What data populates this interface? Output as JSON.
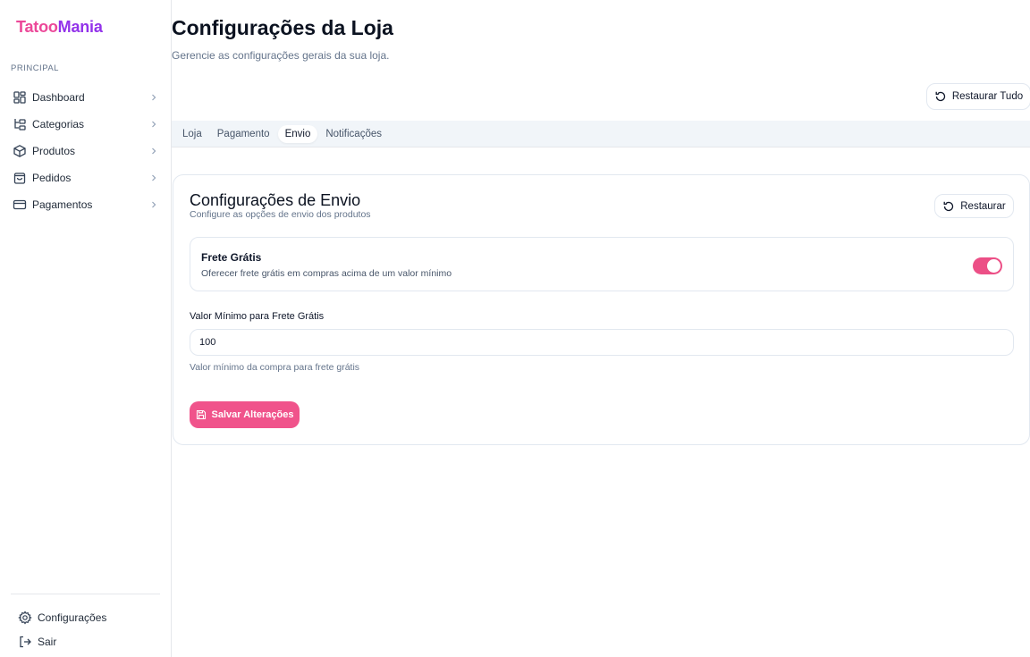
{
  "brand": {
    "part1": "Tatoo",
    "part2": "Mania"
  },
  "sidebar": {
    "section_label": "PRINCIPAL",
    "items": [
      {
        "label": "Dashboard",
        "icon": "dashboard-icon"
      },
      {
        "label": "Categorias",
        "icon": "folder-tree-icon"
      },
      {
        "label": "Produtos",
        "icon": "package-icon"
      },
      {
        "label": "Pedidos",
        "icon": "shopping-bag-icon"
      },
      {
        "label": "Pagamentos",
        "icon": "credit-card-icon"
      }
    ],
    "bottom_items": [
      {
        "label": "Configurações",
        "icon": "gear-icon"
      },
      {
        "label": "Sair",
        "icon": "logout-icon"
      }
    ]
  },
  "page": {
    "title": "Configurações da Loja",
    "subtitle": "Gerencie as configurações gerais da sua loja.",
    "restore_all_label": "Restaurar Tudo"
  },
  "tabs": [
    {
      "label": "Loja",
      "active": false
    },
    {
      "label": "Pagamento",
      "active": false
    },
    {
      "label": "Envio",
      "active": true
    },
    {
      "label": "Notificações",
      "active": false
    }
  ],
  "card": {
    "title": "Configurações de Envio",
    "subtitle": "Configure as opções de envio dos produtos",
    "restore_label": "Restaurar",
    "free_shipping": {
      "title": "Frete Grátis",
      "description": "Oferecer frete grátis em compras acima de um valor mínimo",
      "enabled": true
    },
    "min_value": {
      "label": "Valor Mínimo para Frete Grátis",
      "value": "100",
      "help": "Valor mínimo da compra para frete grátis"
    },
    "save_label": "Salvar Alterações"
  },
  "colors": {
    "brand_pink": "#ec4899",
    "brand_purple": "#9333ea",
    "accent": "#f0538b"
  }
}
